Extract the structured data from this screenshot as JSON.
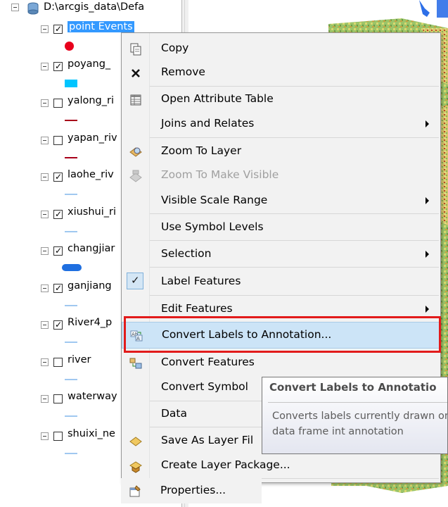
{
  "toc": {
    "root_label": "D:\\arcgis_data\\Defa",
    "layers": [
      {
        "name": "point Events",
        "checked": true,
        "selected": true,
        "symbol": "red-point"
      },
      {
        "name": "poyang_",
        "checked": true,
        "symbol": "cyan-polygon"
      },
      {
        "name": "yalong_ri",
        "checked": false,
        "symbol": "dark-red-line"
      },
      {
        "name": "yapan_riv",
        "checked": false,
        "symbol": "dark-red-line"
      },
      {
        "name": "laohe_riv",
        "checked": true,
        "symbol": "light-blue-line"
      },
      {
        "name": "xiushui_ri",
        "checked": true,
        "symbol": "light-blue-line"
      },
      {
        "name": "changjiar",
        "checked": true,
        "symbol": "blue-pill"
      },
      {
        "name": "ganjiang",
        "checked": true,
        "symbol": "light-blue-line"
      },
      {
        "name": "River4_p",
        "checked": true,
        "symbol": "light-blue-line"
      },
      {
        "name": "river",
        "checked": false,
        "symbol": "light-blue-line"
      },
      {
        "name": "waterway",
        "checked": false,
        "symbol": "light-blue-line"
      },
      {
        "name": "shuixi_ne",
        "checked": false,
        "symbol": "light-blue-line"
      }
    ],
    "colors": {
      "selection": "#3399ff",
      "red_point": "#e8001c",
      "cyan": "#00c5ff",
      "dark_red": "#a8001a",
      "light_blue": "#a0c8f0",
      "blue_pill": "#1f6fe0"
    }
  },
  "context_menu": {
    "items": [
      {
        "label": "Copy",
        "icon": "copy-icon"
      },
      {
        "label": "Remove",
        "icon": "remove-x-icon"
      },
      {
        "label": "Open Attribute Table",
        "icon": "table-icon"
      },
      {
        "label": "Joins and Relates",
        "submenu": true
      },
      {
        "label": "Zoom To Layer",
        "icon": "zoom-to-layer-icon"
      },
      {
        "label": "Zoom To Make Visible",
        "icon": "zoom-visible-icon",
        "disabled": true
      },
      {
        "label": "Visible Scale Range",
        "submenu": true
      },
      {
        "label": "Use Symbol Levels"
      },
      {
        "label": "Selection",
        "submenu": true
      },
      {
        "label": "Label Features",
        "checked": true
      },
      {
        "label": "Edit Features",
        "submenu": true
      },
      {
        "label": "Convert Labels to Annotation...",
        "icon": "convert-labels-icon",
        "highlighted": true
      },
      {
        "label": "Convert Features",
        "icon": "convert-features-icon"
      },
      {
        "label": "Convert Symbol"
      },
      {
        "label": "Data"
      },
      {
        "label": "Save As Layer Fil",
        "icon": "layer-file-icon"
      },
      {
        "label": "Create Layer Package...",
        "icon": "layer-package-icon"
      },
      {
        "label": "Properties...",
        "icon": "properties-icon"
      }
    ]
  },
  "tooltip": {
    "title": "Convert Labels to Annotatio",
    "body": "Converts labels currently drawn on this data frame int annotation"
  },
  "map": {
    "colors": {
      "terrain_green": "#8cc060",
      "terrain_yellow": "#e8e27a",
      "terrain_red": "#c8502a",
      "water_blue": "#2d6fe8"
    }
  }
}
